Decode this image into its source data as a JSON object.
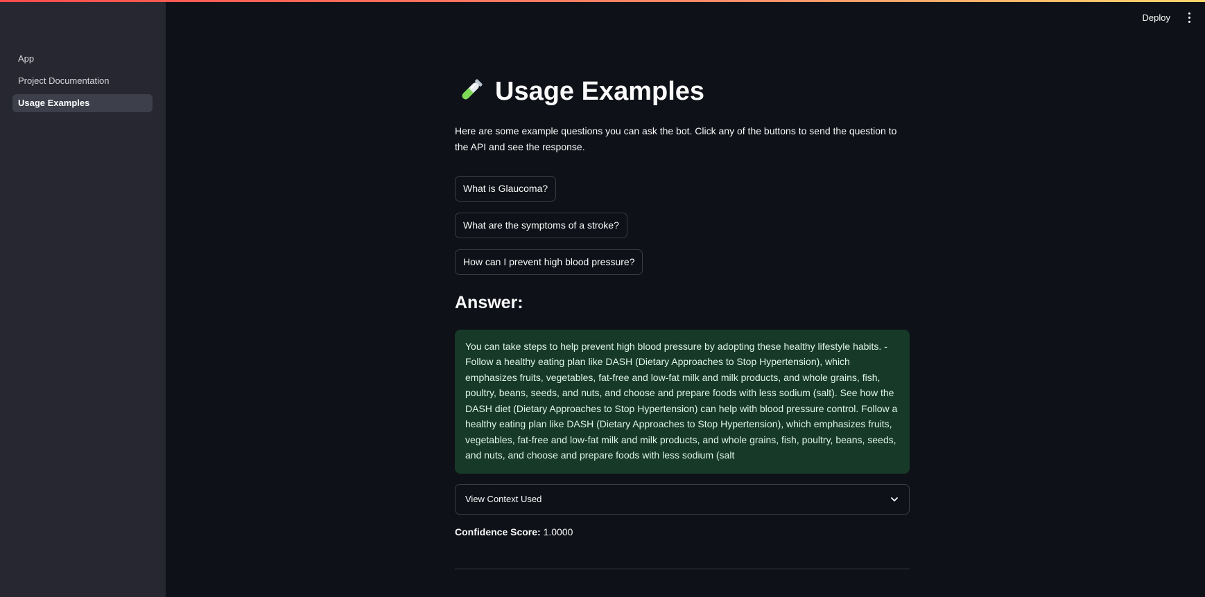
{
  "sidebar": {
    "items": [
      {
        "label": "App",
        "active": false
      },
      {
        "label": "Project Documentation",
        "active": false
      },
      {
        "label": "Usage Examples",
        "active": true
      }
    ]
  },
  "header": {
    "deploy_label": "Deploy",
    "menu_icon": "kebab-menu-icon"
  },
  "main": {
    "title_icon": "test-tube-icon",
    "title": "Usage Examples",
    "intro": "Here are some example questions you can ask the bot. Click any of the buttons to send the question to the API and see the response.",
    "example_buttons": [
      "What is Glaucoma?",
      "What are the symptoms of a stroke?",
      "How can I prevent high blood pressure?"
    ],
    "answer_heading": "Answer:",
    "answer_text": "You can take steps to help prevent high blood pressure by adopting these healthy lifestyle habits. - Follow a healthy eating plan like DASH (Dietary Approaches to Stop Hypertension), which emphasizes fruits, vegetables, fat-free and low-fat milk and milk products, and whole grains, fish, poultry, beans, seeds, and nuts, and choose and prepare foods with less sodium (salt). See how the DASH diet (Dietary Approaches to Stop Hypertension) can help with blood pressure control. Follow a healthy eating plan like DASH (Dietary Approaches to Stop Hypertension), which emphasizes fruits, vegetables, fat-free and low-fat milk and milk products, and whole grains, fish, poultry, beans, seeds, and nuts, and choose and prepare foods with less sodium (salt",
    "expander_label": "View Context Used",
    "confidence_label": "Confidence Score:",
    "confidence_value": "1.0000"
  },
  "colors": {
    "background": "#0e1117",
    "sidebar": "#262730",
    "answer_box": "#173928",
    "accent_gradient_start": "#ff4b4b",
    "accent_gradient_end": "#ffd66b"
  }
}
